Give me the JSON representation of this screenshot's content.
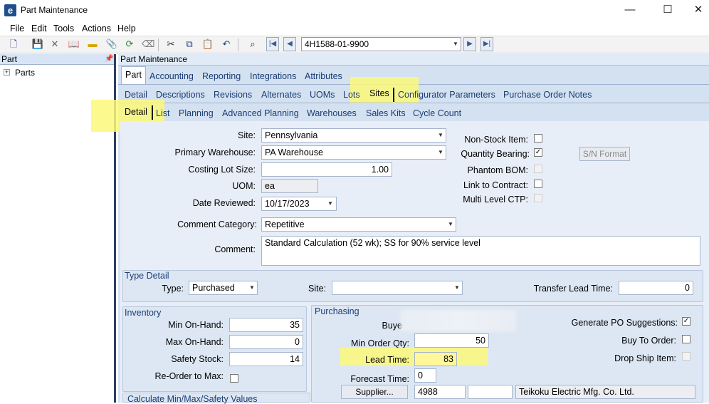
{
  "window": {
    "title": "Part Maintenance",
    "minimize": "—",
    "maximize": "☐",
    "close": "✕"
  },
  "menu": [
    "File",
    "Edit",
    "Tools",
    "Actions",
    "Help"
  ],
  "toolbar": {
    "part_number": "4H1588-01-9900"
  },
  "left_panel": {
    "header": "Part",
    "tree_root": "Parts"
  },
  "main_panel": {
    "header": "Part Maintenance"
  },
  "tabs_level1": [
    "Part",
    "Accounting",
    "Reporting",
    "Integrations",
    "Attributes"
  ],
  "tabs_level2": [
    "Detail",
    "Descriptions",
    "Revisions",
    "Alternates",
    "UOMs",
    "Lots",
    "Sites",
    "Configurator Parameters",
    "Purchase Order Notes"
  ],
  "tabs_level3": [
    "Detail",
    "List",
    "Planning",
    "Advanced Planning",
    "Warehouses",
    "Sales Kits",
    "Cycle Count"
  ],
  "form": {
    "site_label": "Site:",
    "site_value": "Pennsylvania",
    "primary_wh_label": "Primary Warehouse:",
    "primary_wh_value": "PA Warehouse",
    "costing_lot_label": "Costing Lot Size:",
    "costing_lot_value": "1.00",
    "uom_label": "UOM:",
    "uom_value": "ea",
    "date_reviewed_label": "Date Reviewed:",
    "date_reviewed_value": "10/17/2023",
    "comment_cat_label": "Comment Category:",
    "comment_cat_value": "Repetitive",
    "comment_label": "Comment:",
    "comment_value": "Standard Calculation (52 wk); SS for 90% service level",
    "non_stock_label": "Non-Stock Item:",
    "qty_bearing_label": "Quantity Bearing:",
    "phantom_bom_label": "Phantom BOM:",
    "link_contract_label": "Link to Contract:",
    "multi_level_label": "Multi Level CTP:",
    "sn_format_button": "S/N Format"
  },
  "type_detail": {
    "title": "Type Detail",
    "type_label": "Type:",
    "type_value": "Purchased",
    "site_label": "Site:",
    "site_value": "",
    "transfer_lt_label": "Transfer Lead Time:",
    "transfer_lt_value": "0"
  },
  "inventory": {
    "title": "Inventory",
    "min_label": "Min On-Hand:",
    "min_value": "35",
    "max_label": "Max On-Hand:",
    "max_value": "0",
    "safety_label": "Safety Stock:",
    "safety_value": "14",
    "reorder_label": "Re-Order to Max:",
    "calc_title": "Calculate Min/Max/Safety Values"
  },
  "purchasing": {
    "title": "Purchasing",
    "buyer_label": "Buye",
    "min_order_label": "Min Order Qty:",
    "min_order_value": "50",
    "lead_time_label": "Lead Time:",
    "lead_time_value": "83",
    "forecast_label": "Forecast Time:",
    "forecast_value": "0",
    "supplier_button": "Supplier...",
    "supplier_id": "4988",
    "supplier_name": "Teikoku Electric Mfg. Co. Ltd.",
    "gen_po_label": "Generate PO Suggestions:",
    "buy_to_order_label": "Buy To Order:",
    "drop_ship_label": "Drop Ship Item:"
  },
  "colors": {
    "highlight": "#fbf87a",
    "panel_bg": "#d4e1f1",
    "tab_text": "#1a3d74"
  }
}
